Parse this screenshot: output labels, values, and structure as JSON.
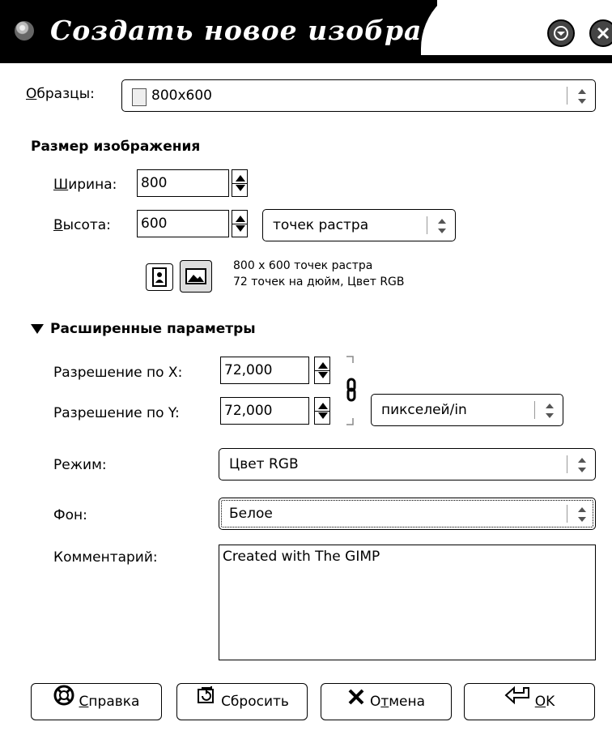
{
  "window": {
    "title": "Создать новое изображение"
  },
  "template": {
    "label_prefix": "О",
    "label_rest": "бразцы:",
    "value": "800x600"
  },
  "image_size": {
    "heading": "Размер изображения",
    "width_label_u": "Ш",
    "width_label_rest": "ирина:",
    "width_value": "800",
    "height_label_u": "В",
    "height_label_rest": "ысота:",
    "height_value": "600",
    "unit": "точек растра",
    "info_line1": "800 x 600 точек растра",
    "info_line2": "72 точек на дюйм, Цвет RGB"
  },
  "advanced": {
    "heading": "Расширенные параметры",
    "res_x_label": "Разрешение по X:",
    "res_x_value": "72,000",
    "res_y_label": "Разрешение по Y:",
    "res_y_value": "72,000",
    "res_unit": "пикселей/in",
    "mode_label": "Режим:",
    "mode_value": "Цвет RGB",
    "fill_label": "Фон:",
    "fill_value": "Белое",
    "comment_label": "Комментарий:",
    "comment_value": "Created with The GIMP"
  },
  "buttons": {
    "help_u": "С",
    "help_rest": "правка",
    "reset": "Сбросить",
    "cancel_pre": "О",
    "cancel_u": "т",
    "cancel_rest": "мена",
    "ok_u": "O",
    "ok_rest": "K"
  }
}
